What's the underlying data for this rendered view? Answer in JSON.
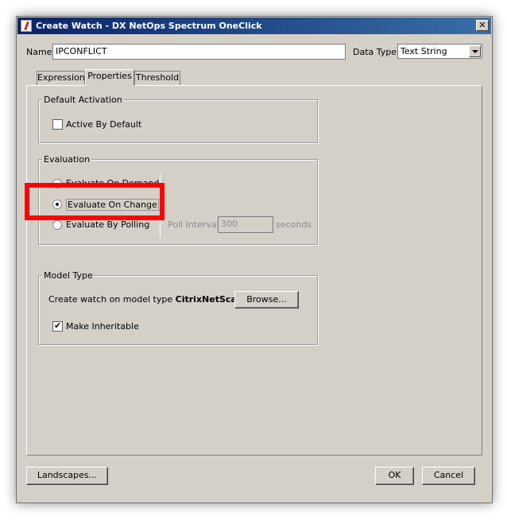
{
  "window": {
    "title": "Create Watch - DX NetOps Spectrum OneClick",
    "close": "✕"
  },
  "name": {
    "label": "Name",
    "value": "IPCONFLICT"
  },
  "data_type": {
    "label": "Data Type",
    "value": "Text String"
  },
  "tabs": [
    {
      "label": "Expression",
      "active": false
    },
    {
      "label": "Properties",
      "active": true
    },
    {
      "label": "Threshold",
      "active": false
    }
  ],
  "default_activation": {
    "title": "Default Activation",
    "active_by_default": {
      "label": "Active By Default",
      "checked": false
    }
  },
  "evaluation": {
    "title": "Evaluation",
    "options": [
      {
        "label": "Evaluate On Demand",
        "checked": false
      },
      {
        "label": "Evaluate On Change",
        "checked": true
      },
      {
        "label": "Evaluate By Polling",
        "checked": false
      }
    ],
    "poll_interval": {
      "label": "Poll Interval",
      "value": "300",
      "unit": "seconds"
    }
  },
  "model_type": {
    "title": "Model Type",
    "text": "Create watch on model type",
    "model": "CitrixNetScaler",
    "browse": "Browse...",
    "inheritable": {
      "label": "Make Inheritable",
      "checked": true
    }
  },
  "buttons": {
    "landscapes": "Landscapes...",
    "ok": "OK",
    "cancel": "Cancel"
  },
  "colors": {
    "highlight": "#ff0000",
    "title_bar": "#0a246a",
    "dialog_bg": "#d4d0c8"
  }
}
